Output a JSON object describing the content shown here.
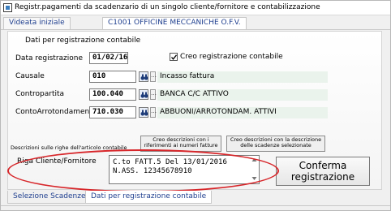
{
  "window": {
    "title": "Registr.pagamenti da scadenzario di un singolo cliente/fornitore e contabilizzazione",
    "icon": "app-window-icon"
  },
  "header_tabs": [
    {
      "label": "Videata iniziale"
    },
    {
      "label": "C1001 OFFICINE MECCANICHE O.F.V."
    }
  ],
  "section": {
    "title": "Dati per registrazione contabile"
  },
  "form": {
    "date": {
      "label": "Data registrazione",
      "value": "01/02/16"
    },
    "create_checkbox": {
      "label": "Creo registrazione contabile",
      "checked": true
    },
    "causale": {
      "label": "Causale",
      "value": "010",
      "description": "Incasso fattura"
    },
    "contropartita": {
      "label": "Contropartita",
      "value": "100.040",
      "description": "BANCA C/C ATTIVO"
    },
    "arrotondamenti": {
      "label": "ContoArrotondamenti",
      "value": "710.030",
      "description": "ABBUONI/ARROTONDAM. ATTIVI"
    }
  },
  "descriptions": {
    "label": "Descrizioni sulle righe dell'articolo contabile",
    "button1": "Creo descrizioni con i riferimenti ai numeri fatture",
    "button2": "Creo descrizioni con la descrizione delle scadenze selezionate"
  },
  "riga": {
    "label": "Riga Cliente/Fornitore",
    "line1": "C.to FATT.5 Del 13/01/2016",
    "line2": "N.ASS. 12345678910"
  },
  "confirm_button": {
    "line1": "Conferma",
    "line2": "registrazione"
  },
  "bottom_tabs": [
    {
      "label": "Selezione Scadenze"
    },
    {
      "label": "Dati per registrazione contabile"
    }
  ],
  "colors": {
    "highlight_ellipse": "#d7262a",
    "description_field_bg": "#eaf3ec",
    "tab_text": "#1f3f8f"
  }
}
